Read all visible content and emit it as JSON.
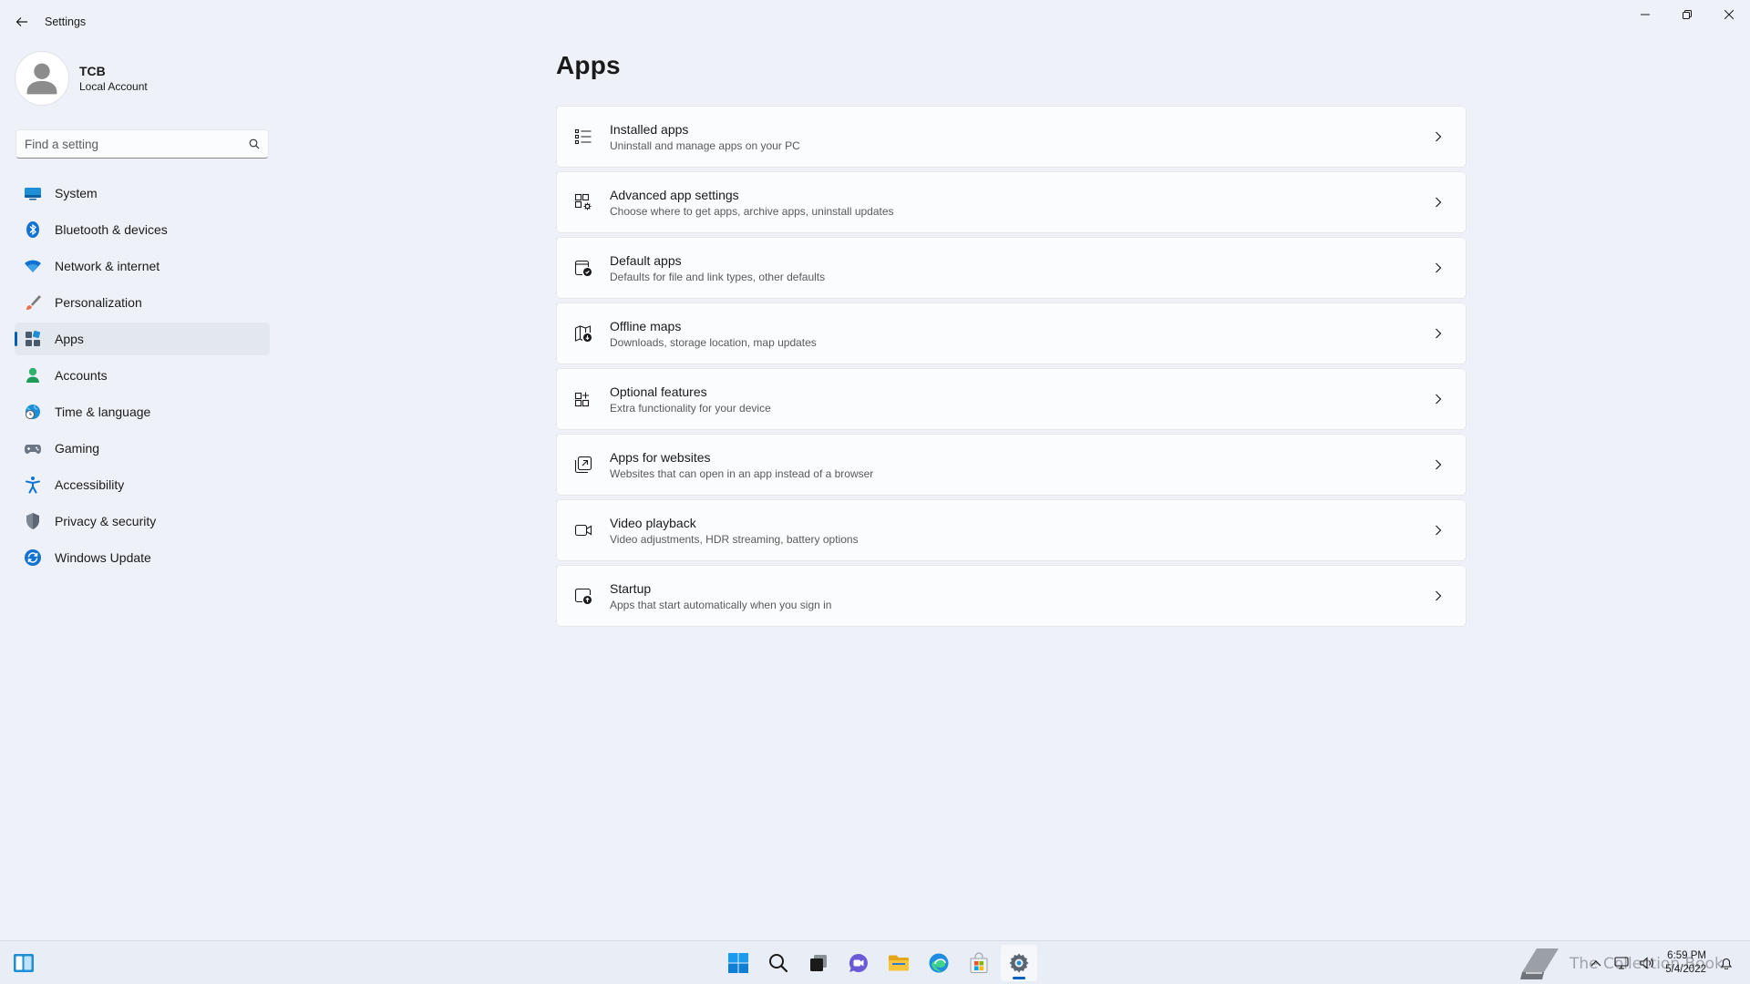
{
  "window": {
    "title": "Settings",
    "controls": [
      "minimize",
      "restore",
      "close"
    ]
  },
  "profile": {
    "name": "TCB",
    "account_type": "Local Account"
  },
  "search": {
    "placeholder": "Find a setting"
  },
  "sidebar": {
    "items": [
      {
        "label": "System",
        "icon": "system-icon",
        "active": false
      },
      {
        "label": "Bluetooth & devices",
        "icon": "bluetooth-icon",
        "active": false
      },
      {
        "label": "Network & internet",
        "icon": "wifi-icon",
        "active": false
      },
      {
        "label": "Personalization",
        "icon": "brush-icon",
        "active": false
      },
      {
        "label": "Apps",
        "icon": "apps-icon",
        "active": true
      },
      {
        "label": "Accounts",
        "icon": "person-icon",
        "active": false
      },
      {
        "label": "Time & language",
        "icon": "globe-clock-icon",
        "active": false
      },
      {
        "label": "Gaming",
        "icon": "gamepad-icon",
        "active": false
      },
      {
        "label": "Accessibility",
        "icon": "accessibility-icon",
        "active": false
      },
      {
        "label": "Privacy & security",
        "icon": "shield-icon",
        "active": false
      },
      {
        "label": "Windows Update",
        "icon": "update-icon",
        "active": false
      }
    ]
  },
  "main": {
    "title": "Apps",
    "cards": [
      {
        "title": "Installed apps",
        "subtitle": "Uninstall and manage apps on your PC",
        "icon": "list-icon"
      },
      {
        "title": "Advanced app settings",
        "subtitle": "Choose where to get apps, archive apps, uninstall updates",
        "icon": "app-settings-icon"
      },
      {
        "title": "Default apps",
        "subtitle": "Defaults for file and link types, other defaults",
        "icon": "default-apps-icon"
      },
      {
        "title": "Offline maps",
        "subtitle": "Downloads, storage location, map updates",
        "icon": "map-icon"
      },
      {
        "title": "Optional features",
        "subtitle": "Extra functionality for your device",
        "icon": "add-grid-icon"
      },
      {
        "title": "Apps for websites",
        "subtitle": "Websites that can open in an app instead of a browser",
        "icon": "open-external-icon"
      },
      {
        "title": "Video playback",
        "subtitle": "Video adjustments, HDR streaming, battery options",
        "icon": "video-icon"
      },
      {
        "title": "Startup",
        "subtitle": "Apps that start automatically when you sign in",
        "icon": "startup-icon"
      }
    ]
  },
  "taskbar": {
    "pinned": [
      "start-icon",
      "search-icon",
      "task-view-icon",
      "chat-icon",
      "file-explorer-icon",
      "edge-icon",
      "store-icon",
      "settings-icon"
    ],
    "active_app": "settings-icon",
    "clock_time": "6:59 PM",
    "clock_date": "5/4/2022",
    "watermark_text": "The Collection Book"
  },
  "colors": {
    "accent": "#005fb8",
    "background": "#eef2f8",
    "card": "#fbfcfd"
  }
}
